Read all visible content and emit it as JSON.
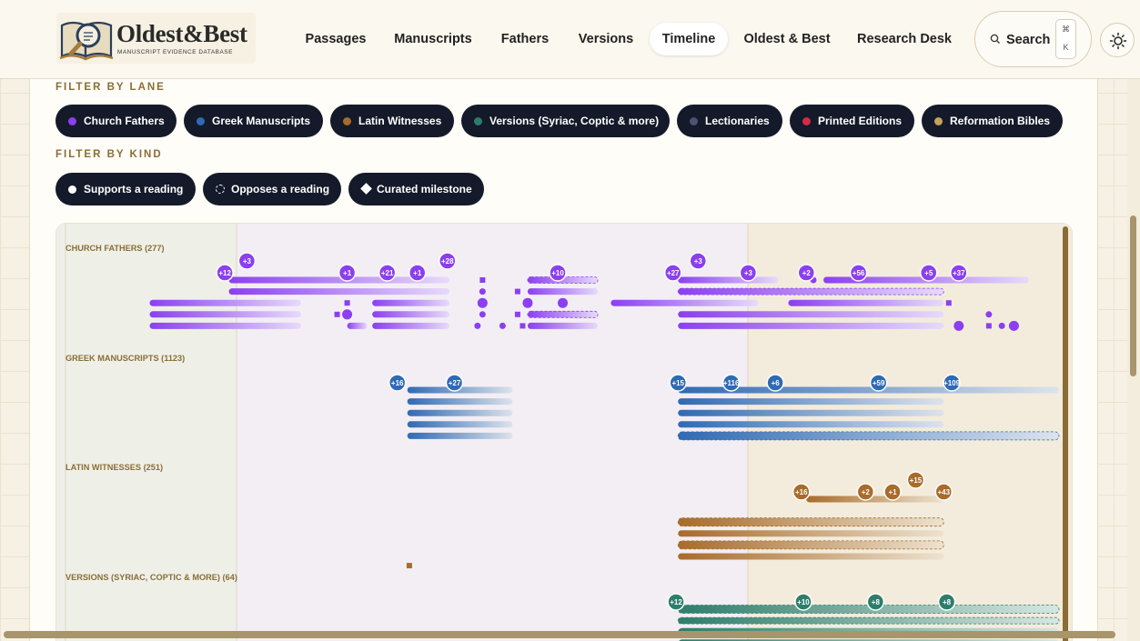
{
  "app": {
    "logo_title": "Oldest&Best",
    "logo_subtitle": "MANUSCRIPT EVIDENCE DATABASE"
  },
  "nav": [
    {
      "label": "Passages",
      "active": false
    },
    {
      "label": "Manuscripts",
      "active": false
    },
    {
      "label": "Fathers",
      "active": false
    },
    {
      "label": "Versions",
      "active": false
    },
    {
      "label": "Timeline",
      "active": true
    },
    {
      "label": "Oldest & Best",
      "active": false
    },
    {
      "label": "Research Desk",
      "active": false
    }
  ],
  "search": {
    "label": "Search",
    "shortcut_top": "⌘",
    "shortcut_bottom": "K",
    "icon": "search-icon"
  },
  "theme_toggle": {
    "icon": "sun-icon"
  },
  "filters": {
    "lane_label": "FILTER BY LANE",
    "kind_label": "FILTER BY KIND",
    "lanes": [
      {
        "label": "Church Fathers",
        "color": "#8b3ff0"
      },
      {
        "label": "Greek Manuscripts",
        "color": "#2f6ab3"
      },
      {
        "label": "Latin Witnesses",
        "color": "#a86b2a"
      },
      {
        "label": "Versions (Syriac, Coptic & more)",
        "color": "#2e7d6b"
      },
      {
        "label": "Lectionaries",
        "color": "#4b5472"
      },
      {
        "label": "Printed Editions",
        "color": "#d42b45"
      },
      {
        "label": "Reformation Bibles",
        "color": "#c5a25a"
      }
    ],
    "kinds": [
      {
        "label": "Supports a reading",
        "marker": "solid"
      },
      {
        "label": "Opposes a reading",
        "marker": "dashed"
      },
      {
        "label": "Curated milestone",
        "marker": "diamond"
      }
    ]
  },
  "timeline": {
    "lanes": [
      {
        "label": "CHURCH FATHERS (277)",
        "color": "#8b3ff0",
        "fade": "#e7dafb",
        "badges": [
          {
            "text": "+12",
            "row": 0,
            "pos": 0.168
          },
          {
            "text": "+3",
            "row": -1,
            "pos": 0.19
          },
          {
            "text": "+1",
            "row": 0,
            "pos": 0.29
          },
          {
            "text": "+21",
            "row": 0,
            "pos": 0.33
          },
          {
            "text": "+1",
            "row": 0,
            "pos": 0.36
          },
          {
            "text": "+28",
            "row": -1,
            "pos": 0.39
          },
          {
            "text": "+10",
            "row": 0,
            "pos": 0.5
          },
          {
            "text": "+27",
            "row": 0,
            "pos": 0.615
          },
          {
            "text": "+3",
            "row": -1,
            "pos": 0.64
          },
          {
            "text": "+3",
            "row": 0,
            "pos": 0.69
          },
          {
            "text": "+2",
            "row": 0,
            "pos": 0.748
          },
          {
            "text": "+56",
            "row": 0,
            "pos": 0.8
          },
          {
            "text": "+5",
            "row": 0,
            "pos": 0.87
          },
          {
            "text": "+37",
            "row": 0,
            "pos": 0.9
          }
        ],
        "bars": [
          {
            "start": 0.172,
            "end": 0.392,
            "row": 1
          },
          {
            "start": 0.172,
            "end": 0.392,
            "row": 2
          },
          {
            "start": 0.093,
            "end": 0.244,
            "row": 3
          },
          {
            "start": 0.315,
            "end": 0.392,
            "row": 3
          },
          {
            "start": 0.093,
            "end": 0.244,
            "row": 4
          },
          {
            "start": 0.315,
            "end": 0.392,
            "row": 4
          },
          {
            "start": 0.093,
            "end": 0.244,
            "row": 5
          },
          {
            "start": 0.29,
            "end": 0.31,
            "row": 5
          },
          {
            "start": 0.315,
            "end": 0.392,
            "row": 5
          },
          {
            "start": 0.47,
            "end": 0.54,
            "row": 1,
            "dashed": true
          },
          {
            "start": 0.47,
            "end": 0.54,
            "row": 2
          },
          {
            "start": 0.47,
            "end": 0.54,
            "row": 4,
            "dashed": true
          },
          {
            "start": 0.47,
            "end": 0.54,
            "row": 5
          },
          {
            "start": 0.553,
            "end": 0.7,
            "row": 3
          },
          {
            "start": 0.62,
            "end": 0.72,
            "row": 1
          },
          {
            "start": 0.62,
            "end": 0.885,
            "row": 2,
            "dashed": true
          },
          {
            "start": 0.73,
            "end": 0.885,
            "row": 3
          },
          {
            "start": 0.62,
            "end": 0.885,
            "row": 4
          },
          {
            "start": 0.62,
            "end": 0.885,
            "row": 5
          },
          {
            "start": 0.765,
            "end": 0.97,
            "row": 1
          }
        ],
        "dots": [
          {
            "pos": 0.425,
            "row": 1,
            "shape": "square"
          },
          {
            "pos": 0.425,
            "row": 2
          },
          {
            "pos": 0.425,
            "row": 3,
            "big": true
          },
          {
            "pos": 0.425,
            "row": 4
          },
          {
            "pos": 0.42,
            "row": 5
          },
          {
            "pos": 0.29,
            "row": 3,
            "shape": "square"
          },
          {
            "pos": 0.28,
            "row": 4,
            "shape": "square"
          },
          {
            "pos": 0.29,
            "row": 4,
            "big": true
          },
          {
            "pos": 0.445,
            "row": 5
          },
          {
            "pos": 0.46,
            "row": 2,
            "shape": "square"
          },
          {
            "pos": 0.46,
            "row": 4,
            "shape": "square"
          },
          {
            "pos": 0.465,
            "row": 5,
            "shape": "square"
          },
          {
            "pos": 0.47,
            "row": 3,
            "big": true
          },
          {
            "pos": 0.505,
            "row": 3,
            "big": true
          },
          {
            "pos": 0.89,
            "row": 3,
            "shape": "square"
          },
          {
            "pos": 0.9,
            "row": 5,
            "big": true
          },
          {
            "pos": 0.93,
            "row": 4
          },
          {
            "pos": 0.93,
            "row": 5,
            "shape": "square"
          },
          {
            "pos": 0.943,
            "row": 5
          },
          {
            "pos": 0.955,
            "row": 5,
            "big": true
          },
          {
            "pos": 0.755,
            "row": 1
          }
        ]
      },
      {
        "label": "GREEK MANUSCRIPTS (1123)",
        "color": "#2f6ab3",
        "fade": "#dde3ec",
        "badges": [
          {
            "text": "+16",
            "row": 0,
            "pos": 0.34
          },
          {
            "text": "+27",
            "row": 0,
            "pos": 0.397
          },
          {
            "text": "+15",
            "row": 0,
            "pos": 0.62
          },
          {
            "text": "+116",
            "row": 0,
            "pos": 0.673
          },
          {
            "text": "+6",
            "row": 0,
            "pos": 0.717
          },
          {
            "text": "+59",
            "row": 0,
            "pos": 0.82
          },
          {
            "text": "+109",
            "row": 0,
            "pos": 0.893
          }
        ],
        "bars": [
          {
            "start": 0.35,
            "end": 0.455,
            "row": 1
          },
          {
            "start": 0.35,
            "end": 0.455,
            "row": 2
          },
          {
            "start": 0.35,
            "end": 0.455,
            "row": 3
          },
          {
            "start": 0.35,
            "end": 0.455,
            "row": 4
          },
          {
            "start": 0.35,
            "end": 0.455,
            "row": 5
          },
          {
            "start": 0.62,
            "end": 1.0,
            "row": 1
          },
          {
            "start": 0.62,
            "end": 0.885,
            "row": 2
          },
          {
            "start": 0.62,
            "end": 0.885,
            "row": 3
          },
          {
            "start": 0.62,
            "end": 0.885,
            "row": 4
          },
          {
            "start": 0.62,
            "end": 1.0,
            "row": 5,
            "thick": true,
            "dashed": true
          }
        ],
        "dots": []
      },
      {
        "label": "LATIN WITNESSES (251)",
        "color": "#a86b2a",
        "fade": "#ede2d0",
        "badges": [
          {
            "text": "+16",
            "row": 0,
            "pos": 0.743
          },
          {
            "text": "+2",
            "row": 0,
            "pos": 0.807
          },
          {
            "text": "+1",
            "row": 0,
            "pos": 0.834
          },
          {
            "text": "+15",
            "row": -1,
            "pos": 0.857
          },
          {
            "text": "+43",
            "row": 0,
            "pos": 0.885
          }
        ],
        "bars": [
          {
            "start": 0.748,
            "end": 0.885,
            "row": 1
          },
          {
            "start": 0.62,
            "end": 0.885,
            "row": 3,
            "thick": true,
            "dashed": true
          },
          {
            "start": 0.62,
            "end": 0.885,
            "row": 4
          },
          {
            "start": 0.62,
            "end": 0.885,
            "row": 5,
            "thick": true,
            "dashed": true
          },
          {
            "start": 0.62,
            "end": 0.885,
            "row": 6
          }
        ],
        "dots": [
          {
            "pos": 0.352,
            "row": 6.8,
            "shape": "square"
          }
        ]
      },
      {
        "label": "VERSIONS (SYRIAC, COPTIC & MORE) (64)",
        "color": "#2e7d6b",
        "fade": "#d8e6e1",
        "badges": [
          {
            "text": "+12",
            "row": 0,
            "pos": 0.618
          },
          {
            "text": "+10",
            "row": 0,
            "pos": 0.745
          },
          {
            "text": "+8",
            "row": 0,
            "pos": 0.817
          },
          {
            "text": "+8",
            "row": 0,
            "pos": 0.888
          }
        ],
        "bars": [
          {
            "start": 0.62,
            "end": 1.0,
            "row": 1,
            "thick": true,
            "dashed": true
          },
          {
            "start": 0.62,
            "end": 1.0,
            "row": 2,
            "dashed": true
          },
          {
            "start": 0.62,
            "end": 1.0,
            "row": 3,
            "thick": true
          },
          {
            "start": 0.62,
            "end": 1.0,
            "row": 4,
            "thick": true
          }
        ],
        "dots": []
      }
    ]
  }
}
